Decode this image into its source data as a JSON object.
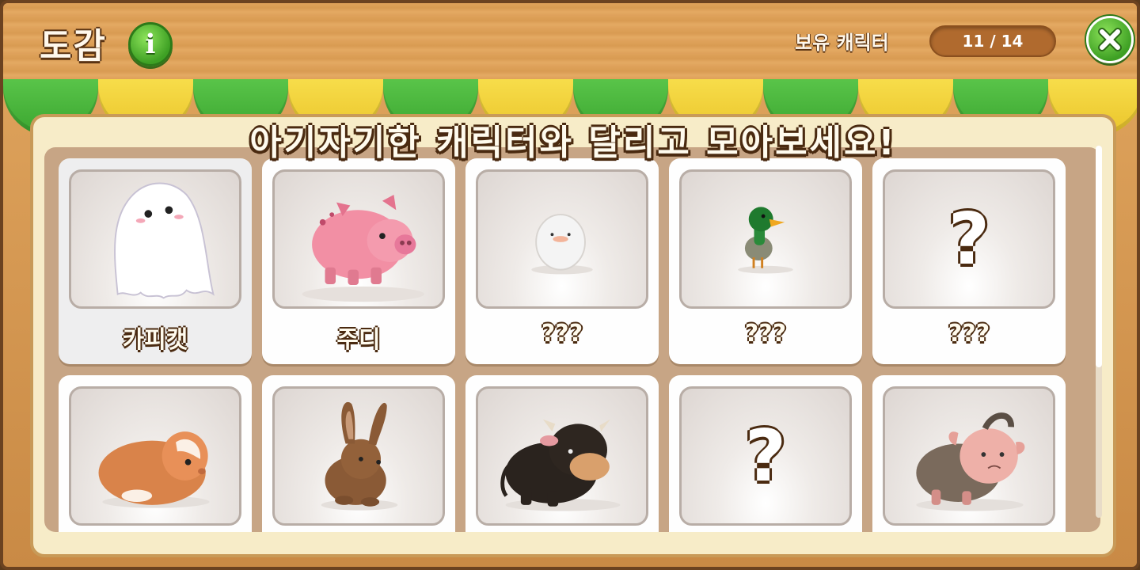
{
  "header": {
    "title": "도감",
    "info_icon": "info-icon",
    "owned_label": "보유 캐릭터",
    "owned_count": "11 / 14",
    "close_icon": "close-icon"
  },
  "banner": "아기자기한 캐릭터와 달리고 모아보세요!",
  "colors": {
    "awning_green": "#4cb83d",
    "awning_yellow": "#f2d23a",
    "wood": "#d99b52"
  },
  "characters": [
    {
      "name": "카피캣",
      "icon": "ghost-icon",
      "selected": true
    },
    {
      "name": "주디",
      "icon": "pig-icon"
    },
    {
      "name": "???",
      "icon": "egg-bird-icon"
    },
    {
      "name": "???",
      "icon": "duck-icon"
    },
    {
      "name": "???",
      "icon": "question-mark-icon",
      "locked_mark": "?"
    },
    {
      "name": "",
      "icon": "guinea-pig-icon"
    },
    {
      "name": "",
      "icon": "rabbit-icon"
    },
    {
      "name": "",
      "icon": "bull-icon"
    },
    {
      "name": "",
      "icon": "question-mark-icon",
      "locked_mark": "?"
    },
    {
      "name": "",
      "icon": "goat-icon"
    }
  ]
}
